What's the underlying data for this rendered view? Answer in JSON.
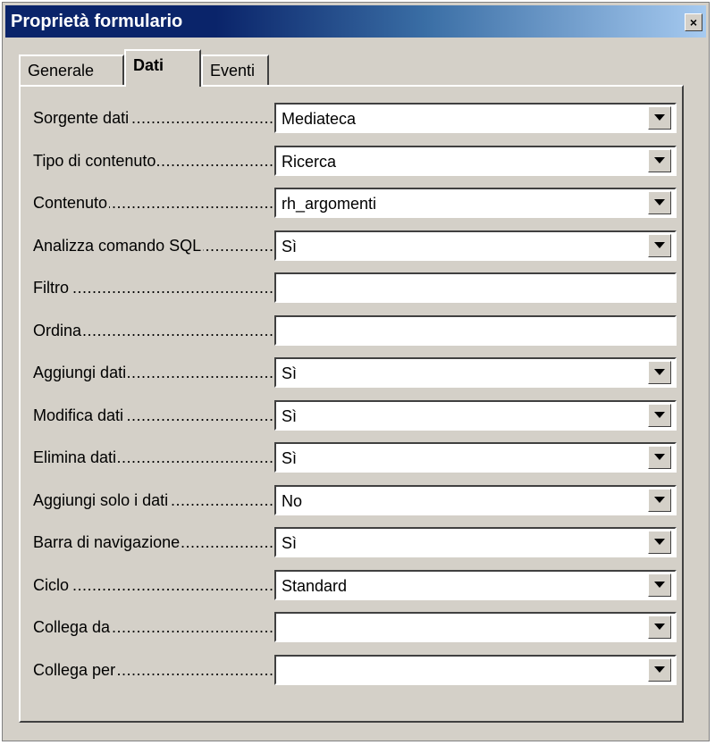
{
  "window": {
    "title": "Proprietà formulario",
    "close_glyph": "×"
  },
  "tabs": [
    {
      "label": "Generale",
      "active": false
    },
    {
      "label": "Dati",
      "active": true
    },
    {
      "label": "Eventi",
      "active": false
    }
  ],
  "rows": [
    {
      "label": "Sorgente dati",
      "value": "Mediateca",
      "type": "dropdown"
    },
    {
      "label": "Tipo di contenuto",
      "value": "Ricerca",
      "type": "dropdown"
    },
    {
      "label": "Contenuto",
      "value": "rh_argomenti",
      "type": "dropdown"
    },
    {
      "label": "Analizza comando SQL",
      "value": "Sì",
      "type": "dropdown"
    },
    {
      "label": "Filtro",
      "value": "",
      "type": "text"
    },
    {
      "label": "Ordina",
      "value": "",
      "type": "text"
    },
    {
      "label": "Aggiungi dati",
      "value": "Sì",
      "type": "dropdown"
    },
    {
      "label": "Modifica dati",
      "value": "Sì",
      "type": "dropdown"
    },
    {
      "label": "Elimina dati",
      "value": "Sì",
      "type": "dropdown"
    },
    {
      "label": "Aggiungi solo i dati",
      "value": "No",
      "type": "dropdown"
    },
    {
      "label": "Barra di navigazione",
      "value": "Sì",
      "type": "dropdown"
    },
    {
      "label": "Ciclo",
      "value": "Standard",
      "type": "dropdown"
    },
    {
      "label": "Collega da",
      "value": "",
      "type": "dropdown"
    },
    {
      "label": "Collega per",
      "value": "",
      "type": "dropdown"
    }
  ],
  "colors": {
    "title_start": "#0a246a",
    "title_end": "#a6caf0",
    "face": "#d4d0c8"
  }
}
